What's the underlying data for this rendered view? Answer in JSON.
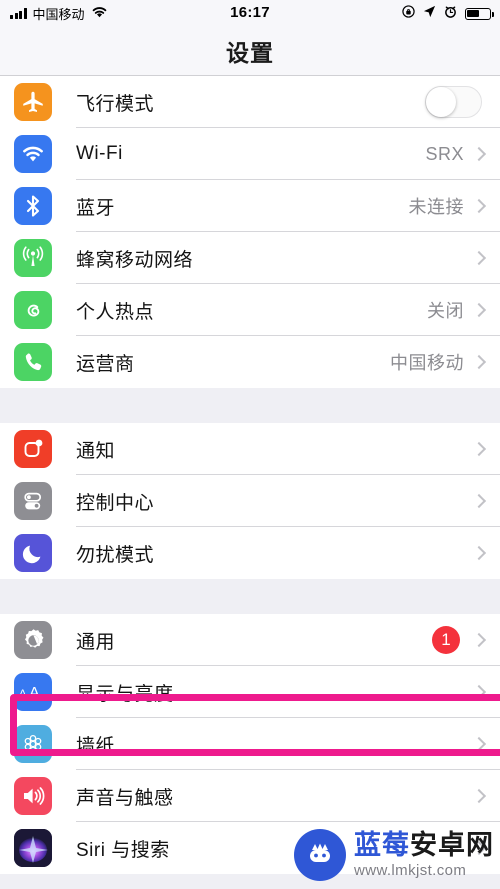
{
  "status_bar": {
    "carrier": "中国移动",
    "time": "16:17",
    "icons": [
      "signal-bars-icon",
      "wifi-icon",
      "rotation-lock-icon",
      "location-arrow-icon",
      "alarm-clock-icon",
      "battery-icon"
    ],
    "battery_level": "56"
  },
  "header": {
    "title": "设置"
  },
  "groups": [
    {
      "rows": [
        {
          "label": "飞行模式",
          "icon": "airplane-icon",
          "icon_color": "#f5931e",
          "accessory": "toggle",
          "toggle_on": false,
          "value": ""
        },
        {
          "label": "Wi-Fi",
          "icon": "wifi-icon",
          "icon_color": "#3778f0",
          "accessory": "chevron",
          "value": "SRX"
        },
        {
          "label": "蓝牙",
          "icon": "bluetooth-icon",
          "icon_color": "#3778f0",
          "accessory": "chevron",
          "value": "未连接"
        },
        {
          "label": "蜂窝移动网络",
          "icon": "cellular-icon",
          "icon_color": "#4cd464",
          "accessory": "chevron",
          "value": ""
        },
        {
          "label": "个人热点",
          "icon": "hotspot-icon",
          "icon_color": "#4cd464",
          "accessory": "chevron",
          "value": "关闭"
        },
        {
          "label": "运营商",
          "icon": "phone-icon",
          "icon_color": "#4cd464",
          "accessory": "chevron",
          "value": "中国移动"
        }
      ]
    },
    {
      "rows": [
        {
          "label": "通知",
          "icon": "notification-icon",
          "icon_color": "#f03e28",
          "accessory": "chevron",
          "value": ""
        },
        {
          "label": "控制中心",
          "icon": "control-center-icon",
          "icon_color": "#8e8e93",
          "accessory": "chevron",
          "value": ""
        },
        {
          "label": "勿扰模式",
          "icon": "moon-icon",
          "icon_color": "#5654d8",
          "accessory": "chevron",
          "value": ""
        }
      ]
    },
    {
      "rows": [
        {
          "label": "通用",
          "icon": "gear-icon",
          "icon_color": "#8e8e93",
          "accessory": "badge",
          "badge": "1",
          "value": ""
        },
        {
          "label": "显示与亮度",
          "icon": "display-aa-icon",
          "icon_color": "#3778f0",
          "accessory": "chevron",
          "value": "",
          "highlighted": true
        },
        {
          "label": "墙纸",
          "icon": "wallpaper-flower-icon",
          "icon_color": "#4fade0",
          "accessory": "chevron",
          "value": ""
        },
        {
          "label": "声音与触感",
          "icon": "speaker-icon",
          "icon_color": "#f4485f",
          "accessory": "chevron",
          "value": ""
        },
        {
          "label": "Siri 与搜索",
          "icon": "siri-icon",
          "icon_color": "#2b2b4a",
          "accessory": "chevron",
          "value": ""
        }
      ]
    }
  ],
  "highlight": {
    "target": "显示与亮度",
    "color": "#ee1a8d"
  },
  "watermark": {
    "brand_blue": "蓝莓",
    "brand_dark": "安卓网",
    "url": "www.lmkjst.com"
  }
}
